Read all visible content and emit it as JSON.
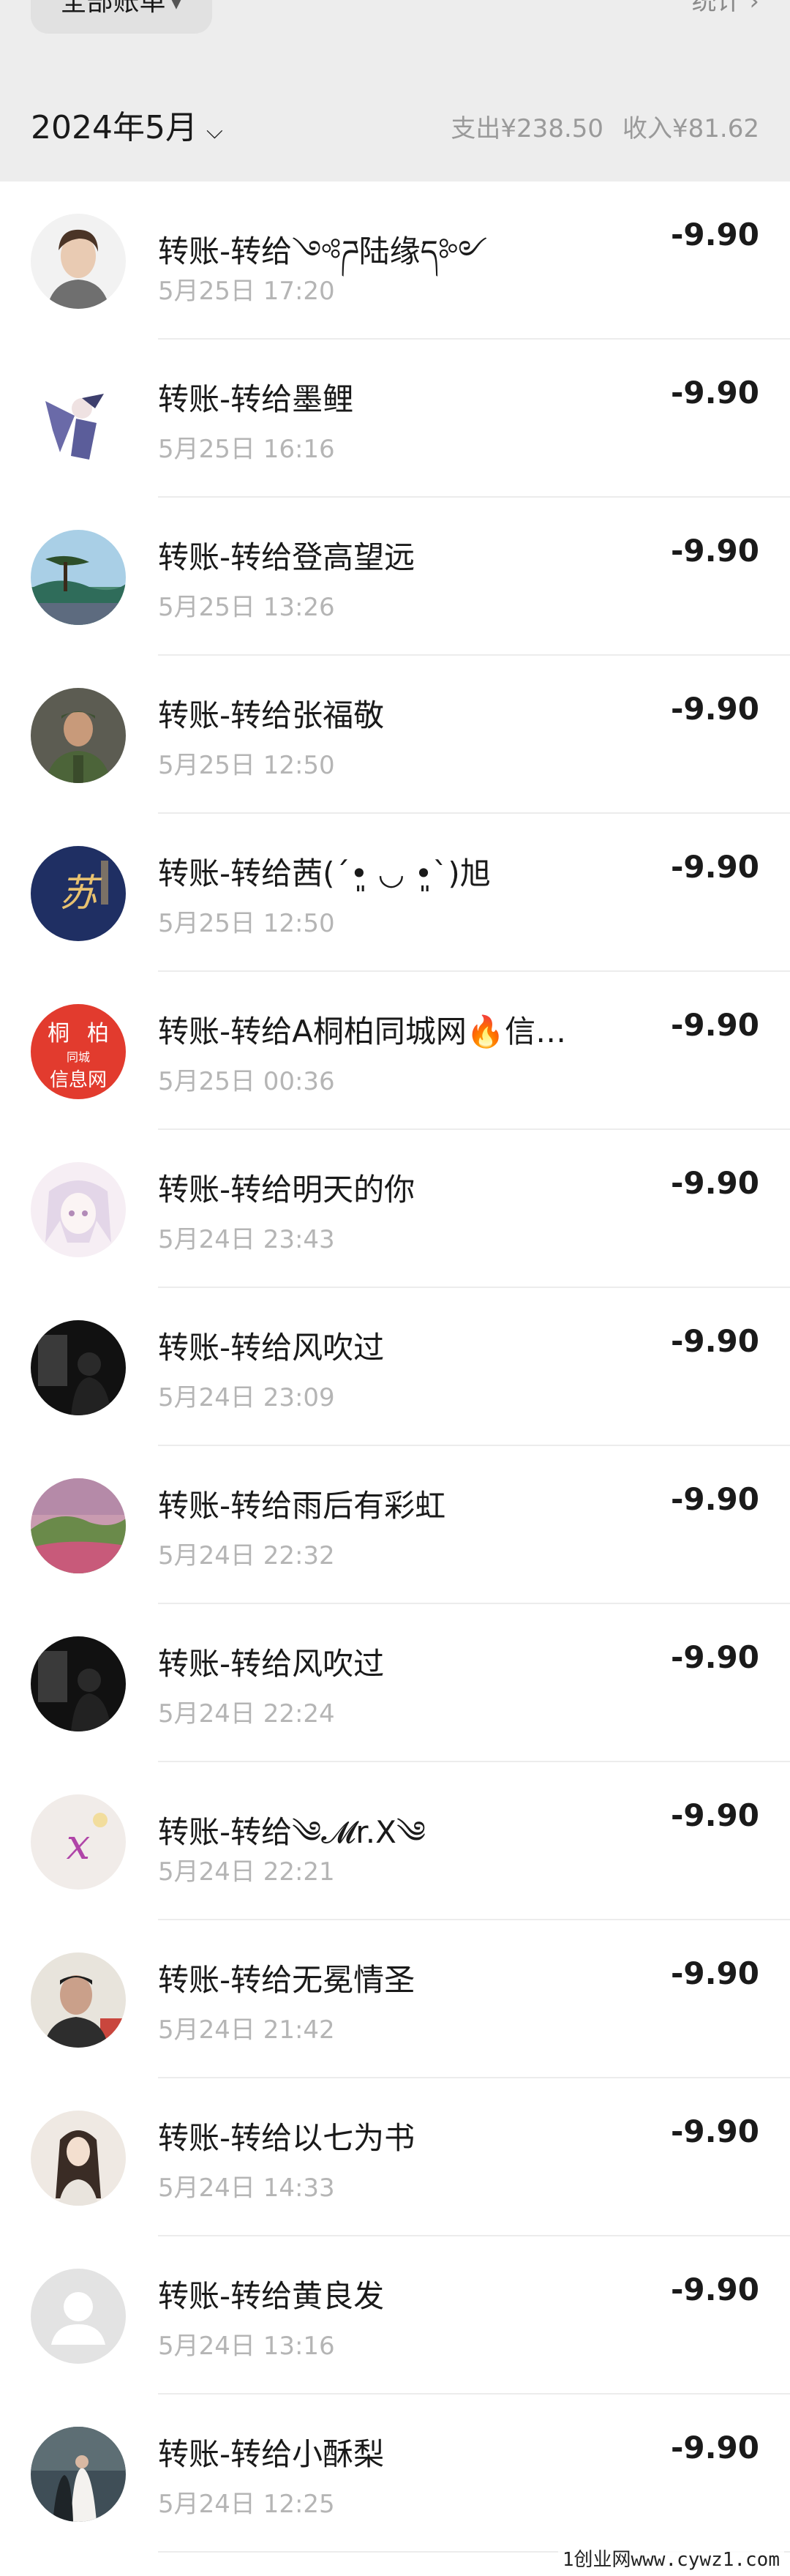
{
  "header": {
    "filter_label": "全部账单",
    "stats_label": "统计 ›",
    "month": "2024年5月",
    "expense": "支出¥238.50",
    "income": "收入¥81.62"
  },
  "transactions": [
    {
      "title": "转账-转给༺ཌ陆缘ད༻",
      "time": "5月25日 17:20",
      "amount": "-9.90",
      "avatar": "man-portrait"
    },
    {
      "title": "转账-转给墨鲤",
      "time": "5月25日 16:16",
      "amount": "-9.90",
      "avatar": "anime-figure"
    },
    {
      "title": "转账-转给登高望远",
      "time": "5月25日 13:26",
      "amount": "-9.90",
      "avatar": "landscape-pine"
    },
    {
      "title": "转账-转给张福敬",
      "time": "5月25日 12:50",
      "amount": "-9.90",
      "avatar": "soldier-photo"
    },
    {
      "title": "转账-转给茜(ˊ•͈ ◡ •͈ˋ)旭",
      "time": "5月25日 12:50",
      "amount": "-9.90",
      "avatar": "calligraphy-blue"
    },
    {
      "title": "转账-转给A桐柏同城网🔥信…",
      "time": "5月25日 00:36",
      "amount": "-9.90",
      "avatar": "tongbai-logo"
    },
    {
      "title": "转账-转给明天的你",
      "time": "5月24日 23:43",
      "amount": "-9.90",
      "avatar": "anime-girl"
    },
    {
      "title": "转账-转给风吹过",
      "time": "5月24日 23:09",
      "amount": "-9.90",
      "avatar": "dark-silhouette"
    },
    {
      "title": "转账-转给雨后有彩虹",
      "time": "5月24日 22:32",
      "amount": "-9.90",
      "avatar": "sunset-hills"
    },
    {
      "title": "转账-转给风吹过",
      "time": "5月24日 22:24",
      "amount": "-9.90",
      "avatar": "dark-silhouette"
    },
    {
      "title": "转账-转给༄𝓜r.X༄",
      "time": "5月24日 22:21",
      "amount": "-9.90",
      "avatar": "letter-x"
    },
    {
      "title": "转账-转给无冕情圣",
      "time": "5月24日 21:42",
      "amount": "-9.90",
      "avatar": "man-selfie"
    },
    {
      "title": "转账-转给以七为书",
      "time": "5月24日 14:33",
      "amount": "-9.90",
      "avatar": "girl-long-hair"
    },
    {
      "title": "转账-转给黄良发",
      "time": "5月24日 13:16",
      "amount": "-9.90",
      "avatar": "default-user"
    },
    {
      "title": "转账-转给小酥梨",
      "time": "5月24日 12:25",
      "amount": "-9.90",
      "avatar": "wedding-photo"
    }
  ],
  "watermark": "1创业网www.cywz1.com"
}
